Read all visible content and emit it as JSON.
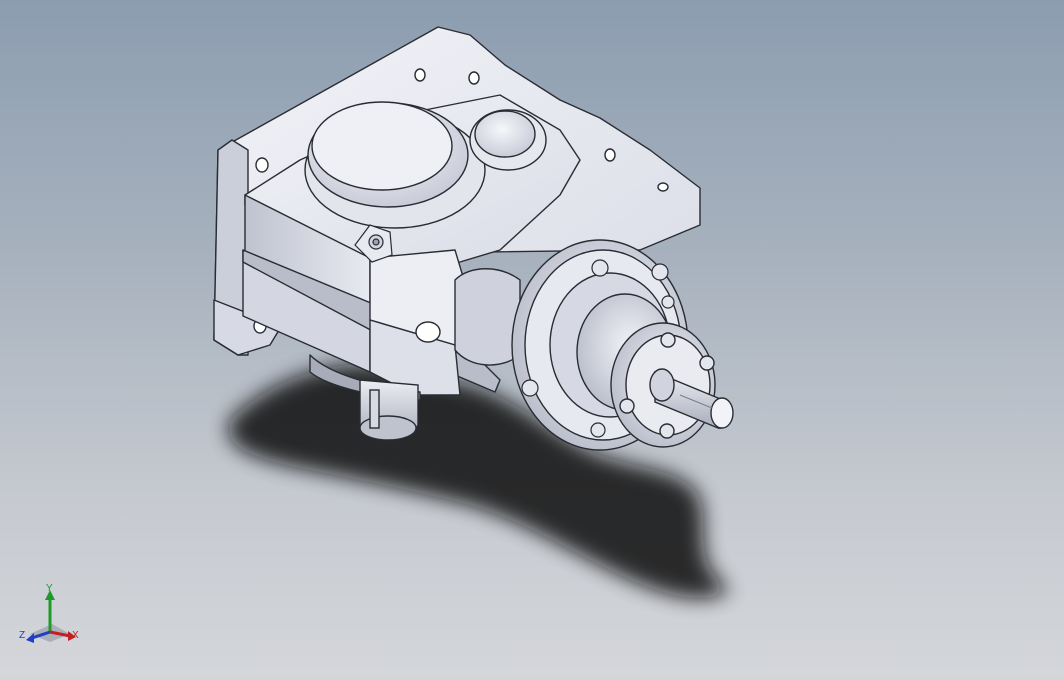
{
  "viewport": {
    "background_top": "#8c9db0",
    "background_bottom": "#d4d6da",
    "model_color": "#dfe1ea",
    "shadow_color": "#000000"
  },
  "triad": {
    "x_label": "X",
    "y_label": "Y",
    "z_label": "Z",
    "x_color": "#c41e1e",
    "y_color": "#1f9a2a",
    "z_color": "#1f3fc4"
  }
}
